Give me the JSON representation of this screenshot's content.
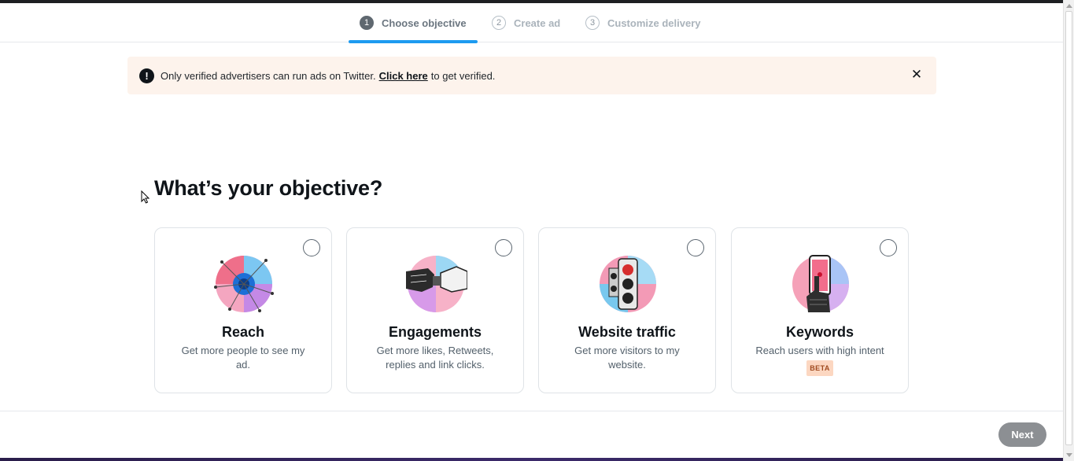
{
  "stepper": {
    "steps": [
      {
        "number": "1",
        "label": "Choose objective"
      },
      {
        "number": "2",
        "label": "Create ad"
      },
      {
        "number": "3",
        "label": "Customize delivery"
      }
    ]
  },
  "alert": {
    "text_before": "Only verified advertisers can run ads on Twitter.",
    "link": "Click here",
    "text_after": "to get verified.",
    "close_glyph": "✕",
    "icon_glyph": "!"
  },
  "main": {
    "heading": "What’s your objective?",
    "objectives": [
      {
        "title": "Reach",
        "description": "Get more people to see my ad."
      },
      {
        "title": "Engagements",
        "description": "Get more likes, Retweets, replies and link clicks."
      },
      {
        "title": "Website traffic",
        "description": "Get more visitors to my website."
      },
      {
        "title": "Keywords",
        "description": "Reach users with high intent",
        "badge": "BETA"
      }
    ]
  },
  "footer": {
    "next_label": "Next"
  },
  "colors": {
    "accent": "#1d9bf0",
    "alert_bg": "#fdf3ec",
    "next_button": "#8c8f93"
  }
}
